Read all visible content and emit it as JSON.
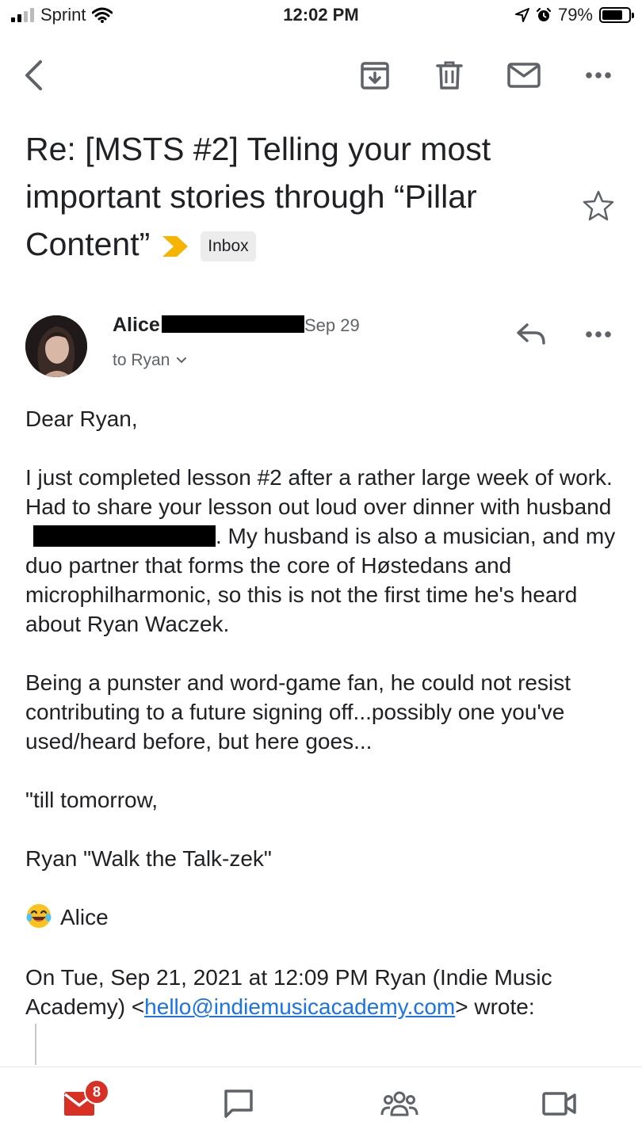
{
  "status_bar": {
    "carrier": "Sprint",
    "time": "12:02 PM",
    "battery_percent": "79%",
    "battery_level": 0.79
  },
  "toolbar": {
    "icons": [
      "back-icon",
      "archive-icon",
      "trash-icon",
      "mail-icon",
      "more-icon"
    ]
  },
  "email": {
    "subject_main": "Re: [MSTS #2] Telling your most important stories through “Pillar Content”",
    "label": "Inbox",
    "sender_first_name": "Alice",
    "date": "Sep 29",
    "recipient_line": "to Ryan",
    "body": {
      "greeting": "Dear Ryan,",
      "para1_before": "I just completed lesson #2 after a rather large week of work. Had to share your lesson out loud over dinner with husband",
      "para1_after": ". My husband is also a musician, and my duo partner that forms the core of Høstedans and microphilharmonic, so this is not the first time he's heard about Ryan Waczek.",
      "para2": "Being a punster and word-game fan, he could not resist contributing to a future signing off...possibly one you've used/heard before, but here goes...",
      "line1": "\"till tomorrow,",
      "line2": "Ryan \"Walk the Talk-zek\"",
      "signature": "Alice",
      "quote_intro": "On Tue, Sep 21, 2021 at 12:09 PM Ryan (Indie Music Academy) <",
      "quote_email": "hello@indiemusicacademy.com",
      "quote_outro": "> wrote:"
    }
  },
  "bottom_nav": {
    "mail_badge": "8",
    "items": [
      "mail-icon",
      "chat-icon",
      "meet-people-icon",
      "video-icon"
    ]
  },
  "colors": {
    "accent_red": "#d93025",
    "link_blue": "#1a73e8",
    "important_yellow": "#f6b400"
  }
}
